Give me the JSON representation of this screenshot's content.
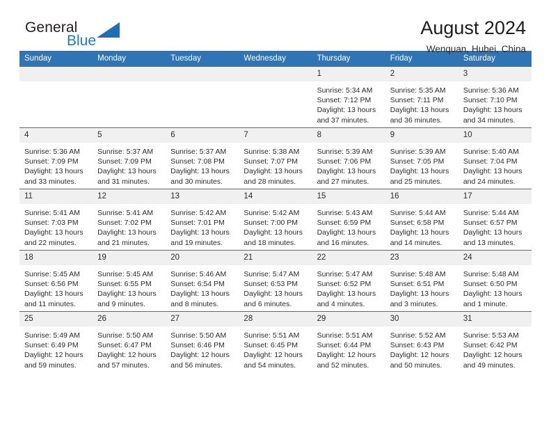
{
  "brand": {
    "name_part1": "General",
    "name_part2": "Blue",
    "triangle_color": "#1d6fb8",
    "blue_color": "#1d7bc4"
  },
  "header": {
    "title": "August 2024",
    "location": "Wenquan, Hubei, China",
    "header_bg": "#2f74b5",
    "daynum_bg": "#f0f0f0"
  },
  "weekdays": [
    "Sunday",
    "Monday",
    "Tuesday",
    "Wednesday",
    "Thursday",
    "Friday",
    "Saturday"
  ],
  "weeks": [
    [
      {
        "day": "",
        "empty": true,
        "sunrise": "",
        "sunset": "",
        "daylight1": "",
        "daylight2": ""
      },
      {
        "day": "",
        "empty": true,
        "sunrise": "",
        "sunset": "",
        "daylight1": "",
        "daylight2": ""
      },
      {
        "day": "",
        "empty": true,
        "sunrise": "",
        "sunset": "",
        "daylight1": "",
        "daylight2": ""
      },
      {
        "day": "",
        "empty": true,
        "sunrise": "",
        "sunset": "",
        "daylight1": "",
        "daylight2": ""
      },
      {
        "day": "1",
        "empty": false,
        "sunrise": "Sunrise: 5:34 AM",
        "sunset": "Sunset: 7:12 PM",
        "daylight1": "Daylight: 13 hours",
        "daylight2": "and 37 minutes."
      },
      {
        "day": "2",
        "empty": false,
        "sunrise": "Sunrise: 5:35 AM",
        "sunset": "Sunset: 7:11 PM",
        "daylight1": "Daylight: 13 hours",
        "daylight2": "and 36 minutes."
      },
      {
        "day": "3",
        "empty": false,
        "sunrise": "Sunrise: 5:36 AM",
        "sunset": "Sunset: 7:10 PM",
        "daylight1": "Daylight: 13 hours",
        "daylight2": "and 34 minutes."
      }
    ],
    [
      {
        "day": "4",
        "empty": false,
        "sunrise": "Sunrise: 5:36 AM",
        "sunset": "Sunset: 7:09 PM",
        "daylight1": "Daylight: 13 hours",
        "daylight2": "and 33 minutes."
      },
      {
        "day": "5",
        "empty": false,
        "sunrise": "Sunrise: 5:37 AM",
        "sunset": "Sunset: 7:09 PM",
        "daylight1": "Daylight: 13 hours",
        "daylight2": "and 31 minutes."
      },
      {
        "day": "6",
        "empty": false,
        "sunrise": "Sunrise: 5:37 AM",
        "sunset": "Sunset: 7:08 PM",
        "daylight1": "Daylight: 13 hours",
        "daylight2": "and 30 minutes."
      },
      {
        "day": "7",
        "empty": false,
        "sunrise": "Sunrise: 5:38 AM",
        "sunset": "Sunset: 7:07 PM",
        "daylight1": "Daylight: 13 hours",
        "daylight2": "and 28 minutes."
      },
      {
        "day": "8",
        "empty": false,
        "sunrise": "Sunrise: 5:39 AM",
        "sunset": "Sunset: 7:06 PM",
        "daylight1": "Daylight: 13 hours",
        "daylight2": "and 27 minutes."
      },
      {
        "day": "9",
        "empty": false,
        "sunrise": "Sunrise: 5:39 AM",
        "sunset": "Sunset: 7:05 PM",
        "daylight1": "Daylight: 13 hours",
        "daylight2": "and 25 minutes."
      },
      {
        "day": "10",
        "empty": false,
        "sunrise": "Sunrise: 5:40 AM",
        "sunset": "Sunset: 7:04 PM",
        "daylight1": "Daylight: 13 hours",
        "daylight2": "and 24 minutes."
      }
    ],
    [
      {
        "day": "11",
        "empty": false,
        "sunrise": "Sunrise: 5:41 AM",
        "sunset": "Sunset: 7:03 PM",
        "daylight1": "Daylight: 13 hours",
        "daylight2": "and 22 minutes."
      },
      {
        "day": "12",
        "empty": false,
        "sunrise": "Sunrise: 5:41 AM",
        "sunset": "Sunset: 7:02 PM",
        "daylight1": "Daylight: 13 hours",
        "daylight2": "and 21 minutes."
      },
      {
        "day": "13",
        "empty": false,
        "sunrise": "Sunrise: 5:42 AM",
        "sunset": "Sunset: 7:01 PM",
        "daylight1": "Daylight: 13 hours",
        "daylight2": "and 19 minutes."
      },
      {
        "day": "14",
        "empty": false,
        "sunrise": "Sunrise: 5:42 AM",
        "sunset": "Sunset: 7:00 PM",
        "daylight1": "Daylight: 13 hours",
        "daylight2": "and 18 minutes."
      },
      {
        "day": "15",
        "empty": false,
        "sunrise": "Sunrise: 5:43 AM",
        "sunset": "Sunset: 6:59 PM",
        "daylight1": "Daylight: 13 hours",
        "daylight2": "and 16 minutes."
      },
      {
        "day": "16",
        "empty": false,
        "sunrise": "Sunrise: 5:44 AM",
        "sunset": "Sunset: 6:58 PM",
        "daylight1": "Daylight: 13 hours",
        "daylight2": "and 14 minutes."
      },
      {
        "day": "17",
        "empty": false,
        "sunrise": "Sunrise: 5:44 AM",
        "sunset": "Sunset: 6:57 PM",
        "daylight1": "Daylight: 13 hours",
        "daylight2": "and 13 minutes."
      }
    ],
    [
      {
        "day": "18",
        "empty": false,
        "sunrise": "Sunrise: 5:45 AM",
        "sunset": "Sunset: 6:56 PM",
        "daylight1": "Daylight: 13 hours",
        "daylight2": "and 11 minutes."
      },
      {
        "day": "19",
        "empty": false,
        "sunrise": "Sunrise: 5:45 AM",
        "sunset": "Sunset: 6:55 PM",
        "daylight1": "Daylight: 13 hours",
        "daylight2": "and 9 minutes."
      },
      {
        "day": "20",
        "empty": false,
        "sunrise": "Sunrise: 5:46 AM",
        "sunset": "Sunset: 6:54 PM",
        "daylight1": "Daylight: 13 hours",
        "daylight2": "and 8 minutes."
      },
      {
        "day": "21",
        "empty": false,
        "sunrise": "Sunrise: 5:47 AM",
        "sunset": "Sunset: 6:53 PM",
        "daylight1": "Daylight: 13 hours",
        "daylight2": "and 6 minutes."
      },
      {
        "day": "22",
        "empty": false,
        "sunrise": "Sunrise: 5:47 AM",
        "sunset": "Sunset: 6:52 PM",
        "daylight1": "Daylight: 13 hours",
        "daylight2": "and 4 minutes."
      },
      {
        "day": "23",
        "empty": false,
        "sunrise": "Sunrise: 5:48 AM",
        "sunset": "Sunset: 6:51 PM",
        "daylight1": "Daylight: 13 hours",
        "daylight2": "and 3 minutes."
      },
      {
        "day": "24",
        "empty": false,
        "sunrise": "Sunrise: 5:48 AM",
        "sunset": "Sunset: 6:50 PM",
        "daylight1": "Daylight: 13 hours",
        "daylight2": "and 1 minute."
      }
    ],
    [
      {
        "day": "25",
        "empty": false,
        "sunrise": "Sunrise: 5:49 AM",
        "sunset": "Sunset: 6:49 PM",
        "daylight1": "Daylight: 12 hours",
        "daylight2": "and 59 minutes."
      },
      {
        "day": "26",
        "empty": false,
        "sunrise": "Sunrise: 5:50 AM",
        "sunset": "Sunset: 6:47 PM",
        "daylight1": "Daylight: 12 hours",
        "daylight2": "and 57 minutes."
      },
      {
        "day": "27",
        "empty": false,
        "sunrise": "Sunrise: 5:50 AM",
        "sunset": "Sunset: 6:46 PM",
        "daylight1": "Daylight: 12 hours",
        "daylight2": "and 56 minutes."
      },
      {
        "day": "28",
        "empty": false,
        "sunrise": "Sunrise: 5:51 AM",
        "sunset": "Sunset: 6:45 PM",
        "daylight1": "Daylight: 12 hours",
        "daylight2": "and 54 minutes."
      },
      {
        "day": "29",
        "empty": false,
        "sunrise": "Sunrise: 5:51 AM",
        "sunset": "Sunset: 6:44 PM",
        "daylight1": "Daylight: 12 hours",
        "daylight2": "and 52 minutes."
      },
      {
        "day": "30",
        "empty": false,
        "sunrise": "Sunrise: 5:52 AM",
        "sunset": "Sunset: 6:43 PM",
        "daylight1": "Daylight: 12 hours",
        "daylight2": "and 50 minutes."
      },
      {
        "day": "31",
        "empty": false,
        "sunrise": "Sunrise: 5:53 AM",
        "sunset": "Sunset: 6:42 PM",
        "daylight1": "Daylight: 12 hours",
        "daylight2": "and 49 minutes."
      }
    ]
  ]
}
